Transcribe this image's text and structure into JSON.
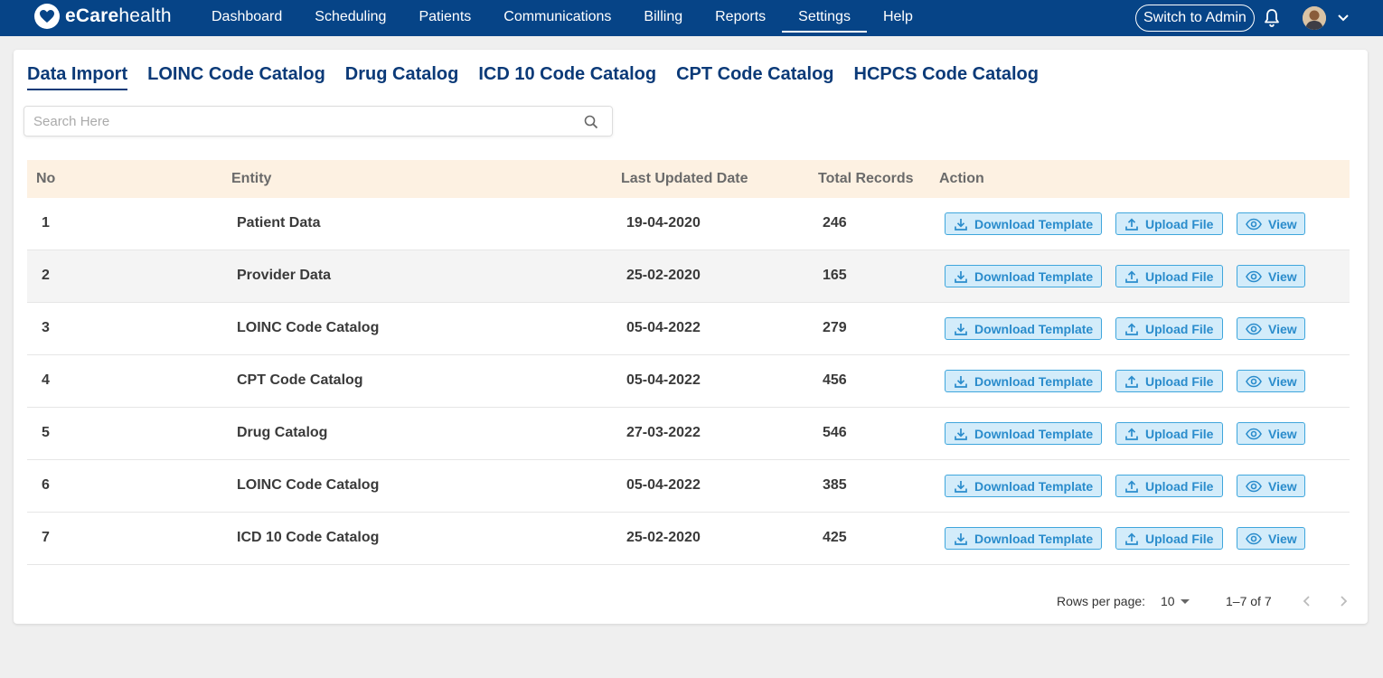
{
  "app": {
    "logo_prefix": "eCare",
    "logo_suffix": "health"
  },
  "nav": {
    "items": [
      {
        "label": "Dashboard",
        "active": false
      },
      {
        "label": "Scheduling",
        "active": false
      },
      {
        "label": "Patients",
        "active": false
      },
      {
        "label": "Communications",
        "active": false
      },
      {
        "label": "Billing",
        "active": false
      },
      {
        "label": "Reports",
        "active": false
      },
      {
        "label": "Settings",
        "active": true
      },
      {
        "label": "Help",
        "active": false
      }
    ],
    "switch_admin_label": "Switch to Admin"
  },
  "tabs": [
    {
      "label": "Data Import",
      "active": true
    },
    {
      "label": "LOINC Code Catalog",
      "active": false
    },
    {
      "label": "Drug Catalog",
      "active": false
    },
    {
      "label": "ICD 10 Code Catalog",
      "active": false
    },
    {
      "label": "CPT Code Catalog",
      "active": false
    },
    {
      "label": "HCPCS Code Catalog",
      "active": false
    }
  ],
  "search": {
    "placeholder": "Search Here",
    "value": ""
  },
  "table": {
    "headers": {
      "no": "No",
      "entity": "Entity",
      "date": "Last Updated Date",
      "total": "Total Records",
      "action": "Action"
    },
    "rows": [
      {
        "no": "1",
        "entity": "Patient Data",
        "date": "19-04-2020",
        "total": "246"
      },
      {
        "no": "2",
        "entity": "Provider Data",
        "date": "25-02-2020",
        "total": "165"
      },
      {
        "no": "3",
        "entity": "LOINC Code Catalog",
        "date": "05-04-2022",
        "total": "279"
      },
      {
        "no": "4",
        "entity": "CPT Code Catalog",
        "date": "05-04-2022",
        "total": "456"
      },
      {
        "no": "5",
        "entity": "Drug Catalog",
        "date": "27-03-2022",
        "total": "546"
      },
      {
        "no": "6",
        "entity": "LOINC Code Catalog",
        "date": "05-04-2022",
        "total": "385"
      },
      {
        "no": "7",
        "entity": "ICD 10 Code Catalog",
        "date": "25-02-2020",
        "total": "425"
      }
    ],
    "actions": {
      "download": "Download Template",
      "upload": "Upload File",
      "view": "View"
    }
  },
  "pagination": {
    "rows_per_page_label": "Rows per page:",
    "rows_per_page_value": "10",
    "range": "1–7 of 7"
  },
  "colors": {
    "nav_bg": "#064487",
    "tab_text": "#0b3a78",
    "header_row_bg": "#fdf1e2",
    "button_bg": "#d3ecfa",
    "button_border": "#3fa6dc",
    "button_text": "#2a8ccc"
  },
  "icons": [
    "heart-logo-icon",
    "bell-icon",
    "avatar",
    "chevron-down-icon",
    "search-icon",
    "download-icon",
    "upload-icon",
    "eye-icon",
    "chevron-left-icon",
    "chevron-right-icon"
  ]
}
